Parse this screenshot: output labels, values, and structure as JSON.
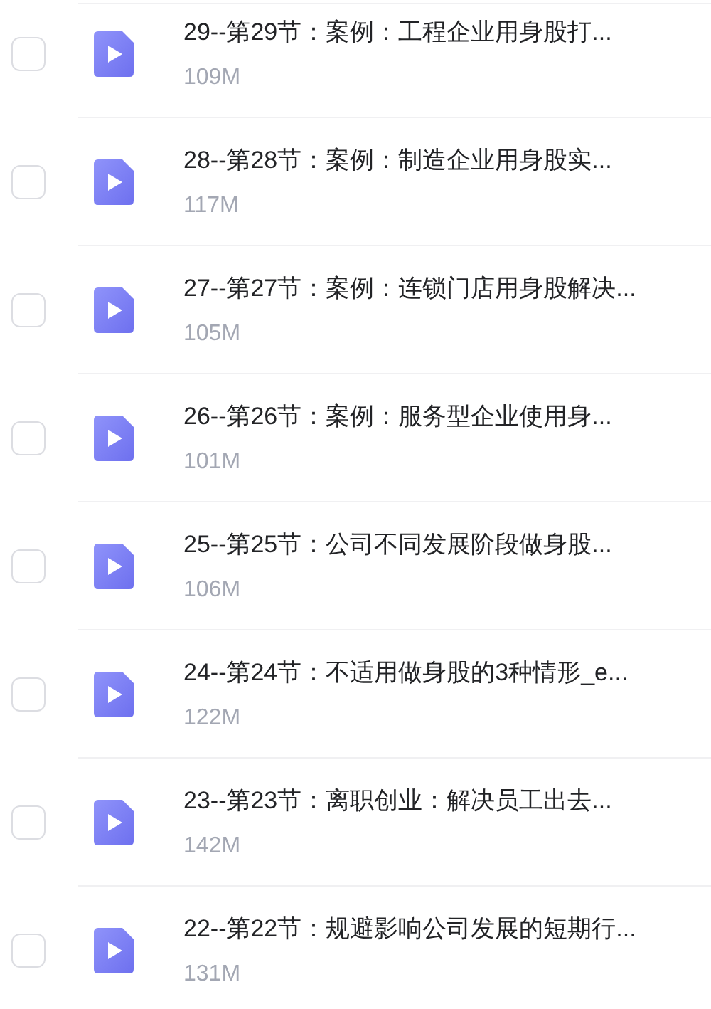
{
  "files": [
    {
      "title": "29--第29节：案例：工程企业用身股打...",
      "size": "109M",
      "checked": false
    },
    {
      "title": "28--第28节：案例：制造企业用身股实...",
      "size": "117M",
      "checked": false
    },
    {
      "title": "27--第27节：案例：连锁门店用身股解决...",
      "size": "105M",
      "checked": false
    },
    {
      "title": "26--第26节：案例：服务型企业使用身...",
      "size": "101M",
      "checked": false
    },
    {
      "title": "25--第25节：公司不同发展阶段做身股...",
      "size": "106M",
      "checked": false
    },
    {
      "title": "24--第24节：不适用做身股的3种情形_e...",
      "size": "122M",
      "checked": false
    },
    {
      "title": "23--第23节：离职创业：解决员工出去...",
      "size": "142M",
      "checked": false
    },
    {
      "title": "22--第22节：规避影响公司发展的短期行...",
      "size": "131M",
      "checked": false
    }
  ]
}
